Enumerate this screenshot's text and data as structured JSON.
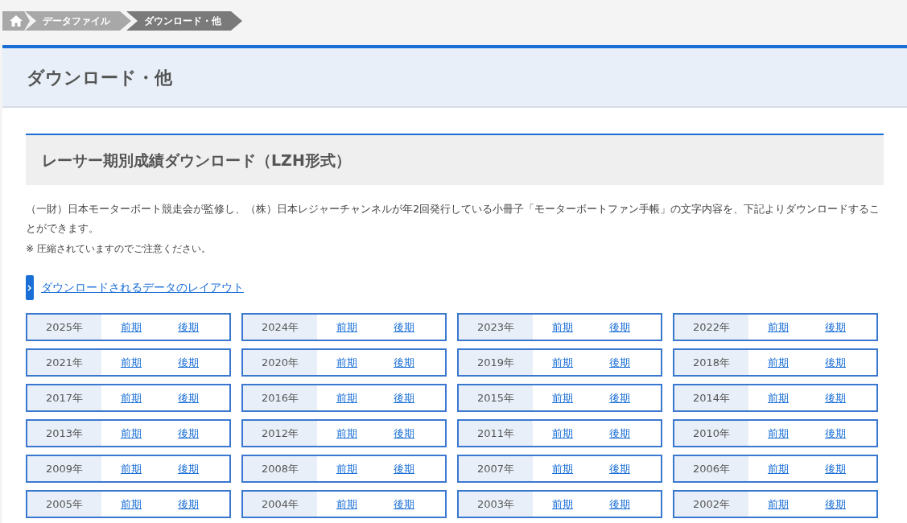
{
  "breadcrumb": [
    {
      "label": "データファイル",
      "selected": false
    },
    {
      "label": "ダウンロード・他",
      "selected": true
    }
  ],
  "page_title": "ダウンロード・他",
  "section_title": "レーサー期別成績ダウンロード（LZH形式）",
  "description": "（一財）日本モーターボート競走会が監修し、（株）日本レジャーチャンネルが年2回発行している小冊子「モーターボートファン手帳」の文字内容を、下記よりダウンロードすることができます。",
  "note": "※ 圧縮されていますのでご注意ください。",
  "layout_link": "ダウンロードされるデータのレイアウト",
  "years": [
    {
      "year": "2025年",
      "first": "前期",
      "second": "後期"
    },
    {
      "year": "2024年",
      "first": "前期",
      "second": "後期"
    },
    {
      "year": "2023年",
      "first": "前期",
      "second": "後期"
    },
    {
      "year": "2022年",
      "first": "前期",
      "second": "後期"
    },
    {
      "year": "2021年",
      "first": "前期",
      "second": "後期"
    },
    {
      "year": "2020年",
      "first": "前期",
      "second": "後期"
    },
    {
      "year": "2019年",
      "first": "前期",
      "second": "後期"
    },
    {
      "year": "2018年",
      "first": "前期",
      "second": "後期"
    },
    {
      "year": "2017年",
      "first": "前期",
      "second": "後期"
    },
    {
      "year": "2016年",
      "first": "前期",
      "second": "後期"
    },
    {
      "year": "2015年",
      "first": "前期",
      "second": "後期"
    },
    {
      "year": "2014年",
      "first": "前期",
      "second": "後期"
    },
    {
      "year": "2013年",
      "first": "前期",
      "second": "後期"
    },
    {
      "year": "2012年",
      "first": "前期",
      "second": "後期"
    },
    {
      "year": "2011年",
      "first": "前期",
      "second": "後期"
    },
    {
      "year": "2010年",
      "first": "前期",
      "second": "後期"
    },
    {
      "year": "2009年",
      "first": "前期",
      "second": "後期"
    },
    {
      "year": "2008年",
      "first": "前期",
      "second": "後期"
    },
    {
      "year": "2007年",
      "first": "前期",
      "second": "後期"
    },
    {
      "year": "2006年",
      "first": "前期",
      "second": "後期"
    },
    {
      "year": "2005年",
      "first": "前期",
      "second": "後期"
    },
    {
      "year": "2004年",
      "first": "前期",
      "second": "後期"
    },
    {
      "year": "2003年",
      "first": "前期",
      "second": "後期"
    },
    {
      "year": "2002年",
      "first": "前期",
      "second": "後期"
    }
  ]
}
